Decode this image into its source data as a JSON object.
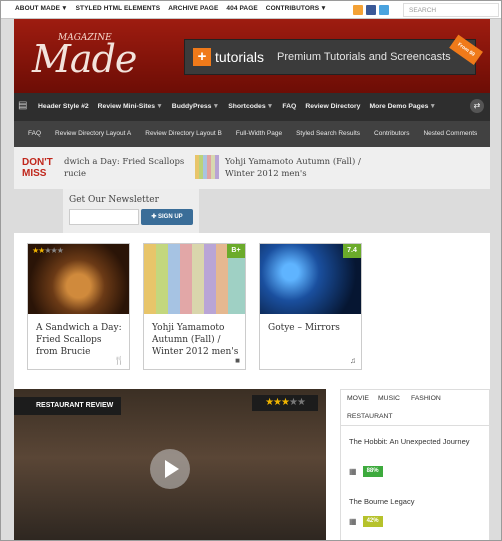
{
  "topbar": {
    "nav": [
      {
        "label": "ABOUT MADE",
        "has_caret": true
      },
      {
        "label": "STYLED HTML ELEMENTS",
        "has_caret": false
      },
      {
        "label": "ARCHIVE PAGE",
        "has_caret": false
      },
      {
        "label": "404 PAGE",
        "has_caret": false
      },
      {
        "label": "CONTRIBUTORS",
        "has_caret": true
      }
    ],
    "social": [
      {
        "icon": "rss-icon",
        "color": "#f4a236"
      },
      {
        "icon": "facebook-icon",
        "color": "#3b5998"
      },
      {
        "icon": "twitter-icon",
        "color": "#4aa3df"
      }
    ],
    "search_placeholder": "SEARCH"
  },
  "header": {
    "logo_small": "MAGAZINE",
    "logo_large": "Made",
    "banner": {
      "plus": "+",
      "brand": "tutorials",
      "tagline": "Premium Tutorials and Screencasts",
      "ribbon": "From $9"
    }
  },
  "nav1": {
    "items": [
      {
        "label": "Header Style #2",
        "has_caret": false
      },
      {
        "label": "Review Mini-Sites",
        "has_caret": true
      },
      {
        "label": "BuddyPress",
        "has_caret": true
      },
      {
        "label": "Shortcodes",
        "has_caret": true
      },
      {
        "label": "FAQ",
        "has_caret": false
      },
      {
        "label": "Review Directory",
        "has_caret": false
      },
      {
        "label": "More Demo Pages",
        "has_caret": true
      }
    ]
  },
  "nav2": {
    "items": [
      "FAQ",
      "Review Directory Layout A",
      "Review Directory Layout B",
      "Full-Width Page",
      "Styled Search Results",
      "Contributors",
      "Nested Comments"
    ]
  },
  "dont_miss": {
    "label_line1": "DON'T",
    "label_line2": "MISS",
    "item1": "dwich a Day: Fried Scallops rucie",
    "item2": "Yohji Yamamoto Autumn (Fall) / Winter 2012 men's"
  },
  "newsletter": {
    "title": "Get Our Newsletter",
    "button": "SIGN UP"
  },
  "cards": [
    {
      "title": "A Sandwich a Day: Fried Scallops from Brucie",
      "badge": "",
      "badge_color": "",
      "stars_on": "★★",
      "stars_off": "★★★",
      "icon": "utensils-icon",
      "icon_glyph": "🍴"
    },
    {
      "title": "Yohji Yamamoto Autumn (Fall) / Winter 2012 men's",
      "badge": "B+",
      "badge_color": "#6bab2b",
      "stars_on": "",
      "stars_off": "",
      "icon": "bag-icon",
      "icon_glyph": "■"
    },
    {
      "title": "Gotye – Mirrors",
      "badge": "7.4",
      "badge_color": "#6bab2b",
      "stars_on": "",
      "stars_off": "",
      "icon": "music-note-icon",
      "icon_glyph": "♫"
    }
  ],
  "feature": {
    "label": "RESTAURANT REVIEW",
    "stars_on": "★★★",
    "stars_off": "★★"
  },
  "tabs": {
    "items": [
      "MOVIE",
      "MUSIC",
      "FASHION",
      "RESTAURANT"
    ],
    "active": "MOVIE",
    "reviews": [
      {
        "title": "The Hobbit: An Unexpected Journey",
        "score": "88%",
        "score_color": "#3daa3d"
      },
      {
        "title": "The Bourne Legacy",
        "score": "42%",
        "score_color": "#b6c22b"
      }
    ]
  }
}
